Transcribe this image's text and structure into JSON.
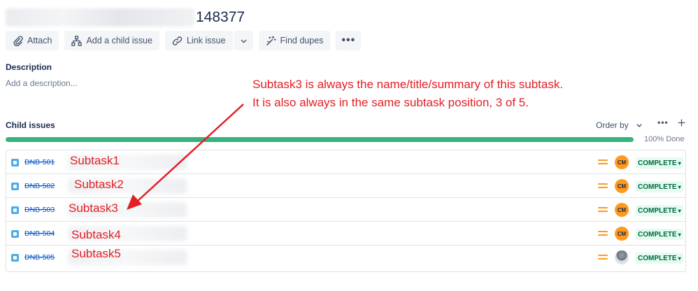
{
  "issue": {
    "title_suffix": "148377"
  },
  "toolbar": {
    "attach": "Attach",
    "add_child": "Add a child issue",
    "link_issue": "Link issue",
    "find_dupes": "Find dupes",
    "more": "•••"
  },
  "description": {
    "label": "Description",
    "placeholder": "Add a description..."
  },
  "annotation": {
    "line1": "Subtask3 is always the name/title/summary of this subtask.",
    "line2": "It is also always in the same subtask position, 3 of 5."
  },
  "child_issues": {
    "label": "Child issues",
    "order_by": "Order by",
    "progress_text": "100% Done",
    "progress_fraction": 1.0,
    "rows": [
      {
        "key": "DNB-501",
        "summary": "Subtask1",
        "assignee": "CM",
        "status": "COMPLETE"
      },
      {
        "key": "DNB-502",
        "summary": "Subtask2",
        "assignee": "CM",
        "status": "COMPLETE"
      },
      {
        "key": "DNB-503",
        "summary": "Subtask3",
        "assignee": "CM",
        "status": "COMPLETE"
      },
      {
        "key": "DNB-504",
        "summary": "Subtask4",
        "assignee": "CM",
        "status": "COMPLETE"
      },
      {
        "key": "DNB-505",
        "summary": "Subtask5",
        "assignee": "",
        "status": "COMPLETE"
      }
    ]
  },
  "colors": {
    "annotation": "#e31e24",
    "progress": "#36b37e",
    "priority": "#ff991f",
    "status_bg": "#e3fcef",
    "status_text": "#006644",
    "link": "#0052cc"
  },
  "icons": {
    "attach": "paperclip-icon",
    "add_child": "hierarchy-icon",
    "link_issue": "link-icon",
    "find_dupes": "magic-wand-icon",
    "priority": "medium-priority-icon",
    "issue_type": "subtask-icon"
  }
}
